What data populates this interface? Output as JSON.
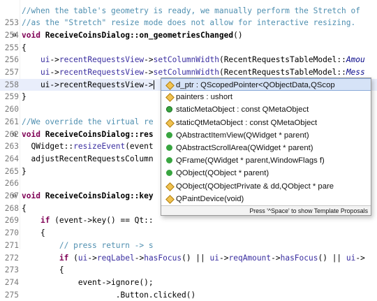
{
  "lines": [
    {
      "num": "",
      "fold": "",
      "tokens": [
        {
          "c": "cm",
          "t": "//when the table's geometry is ready, we manually perform the Stretch of"
        }
      ]
    },
    {
      "num": "253",
      "fold": "",
      "tokens": [
        {
          "c": "cm",
          "t": "//as the \"Stretch\" resize mode does not allow for interactive resizing."
        }
      ]
    },
    {
      "num": "254",
      "fold": "⊖",
      "tokens": [
        {
          "c": "kw",
          "t": "void"
        },
        {
          "c": "pl",
          "t": " "
        },
        {
          "c": "fnb",
          "t": "ReceiveCoinsDialog::on_geometriesChanged"
        },
        {
          "c": "pl",
          "t": "()"
        }
      ]
    },
    {
      "num": "255",
      "fold": "",
      "tokens": [
        {
          "c": "pl",
          "t": "{"
        }
      ]
    },
    {
      "num": "256",
      "fold": "",
      "tokens": [
        {
          "c": "pl",
          "t": "    "
        },
        {
          "c": "fn",
          "t": "ui"
        },
        {
          "c": "pl",
          "t": "->"
        },
        {
          "c": "fn",
          "t": "recentRequestsView"
        },
        {
          "c": "pl",
          "t": "->"
        },
        {
          "c": "fn",
          "t": "setColumnWidth"
        },
        {
          "c": "pl",
          "t": "(RecentRequestsTableModel::"
        },
        {
          "c": "it",
          "t": "Amou"
        }
      ]
    },
    {
      "num": "257",
      "fold": "",
      "tokens": [
        {
          "c": "pl",
          "t": "    "
        },
        {
          "c": "fn",
          "t": "ui"
        },
        {
          "c": "pl",
          "t": "->"
        },
        {
          "c": "fn",
          "t": "recentRequestsView"
        },
        {
          "c": "pl",
          "t": "->"
        },
        {
          "c": "fn",
          "t": "setColumnWidth"
        },
        {
          "c": "pl",
          "t": "(RecentRequestsTableModel::"
        },
        {
          "c": "it",
          "t": "Mess"
        }
      ]
    },
    {
      "num": "258",
      "fold": "",
      "hl": true,
      "caret": true,
      "tokens": [
        {
          "c": "pl",
          "t": "    ui->recentRequestsView->"
        }
      ]
    },
    {
      "num": "259",
      "fold": "",
      "tokens": [
        {
          "c": "pl",
          "t": "}"
        }
      ]
    },
    {
      "num": "260",
      "fold": "",
      "tokens": []
    },
    {
      "num": "261",
      "fold": "",
      "tokens": [
        {
          "c": "cm",
          "t": "//We override the virtual re                              et's c"
        }
      ]
    },
    {
      "num": "262",
      "fold": "⊖",
      "tokens": [
        {
          "c": "kw",
          "t": "void"
        },
        {
          "c": "pl",
          "t": " "
        },
        {
          "c": "fnb",
          "t": "ReceiveCoinsDialog::res"
        }
      ]
    },
    {
      "num": "263",
      "fold": "",
      "tokens": [
        {
          "c": "pl",
          "t": "  QWidget::"
        },
        {
          "c": "fn",
          "t": "resizeEvent"
        },
        {
          "c": "pl",
          "t": "(event"
        }
      ]
    },
    {
      "num": "264",
      "fold": "",
      "tokens": [
        {
          "c": "pl",
          "t": "  adjustRecentRequestsColumn"
        }
      ]
    },
    {
      "num": "265",
      "fold": "",
      "tokens": [
        {
          "c": "pl",
          "t": "}"
        }
      ]
    },
    {
      "num": "266",
      "fold": "",
      "tokens": []
    },
    {
      "num": "267",
      "fold": "⊖",
      "tokens": [
        {
          "c": "kw",
          "t": "void"
        },
        {
          "c": "pl",
          "t": " "
        },
        {
          "c": "fnb",
          "t": "ReceiveCoinsDialog::key"
        }
      ]
    },
    {
      "num": "268",
      "fold": "",
      "tokens": [
        {
          "c": "pl",
          "t": "{"
        }
      ]
    },
    {
      "num": "269",
      "fold": "",
      "tokens": [
        {
          "c": "pl",
          "t": "    "
        },
        {
          "c": "kw",
          "t": "if"
        },
        {
          "c": "pl",
          "t": " (event->key() == Qt::"
        }
      ]
    },
    {
      "num": "270",
      "fold": "",
      "tokens": [
        {
          "c": "pl",
          "t": "    {"
        }
      ]
    },
    {
      "num": "271",
      "fold": "",
      "tokens": [
        {
          "c": "pl",
          "t": "        "
        },
        {
          "c": "cm",
          "t": "// press return -> s"
        }
      ]
    },
    {
      "num": "272",
      "fold": "",
      "tokens": [
        {
          "c": "pl",
          "t": "        "
        },
        {
          "c": "kw",
          "t": "if"
        },
        {
          "c": "pl",
          "t": " ("
        },
        {
          "c": "fn",
          "t": "ui"
        },
        {
          "c": "pl",
          "t": "->"
        },
        {
          "c": "fn",
          "t": "reqLabel"
        },
        {
          "c": "pl",
          "t": "->"
        },
        {
          "c": "fn",
          "t": "hasFocus"
        },
        {
          "c": "pl",
          "t": "() || "
        },
        {
          "c": "fn",
          "t": "ui"
        },
        {
          "c": "pl",
          "t": "->"
        },
        {
          "c": "fn",
          "t": "reqAmount"
        },
        {
          "c": "pl",
          "t": "->"
        },
        {
          "c": "fn",
          "t": "hasFocus"
        },
        {
          "c": "pl",
          "t": "() || "
        },
        {
          "c": "fn",
          "t": "ui"
        },
        {
          "c": "pl",
          "t": "->"
        }
      ]
    },
    {
      "num": "273",
      "fold": "",
      "tokens": [
        {
          "c": "pl",
          "t": "        {"
        }
      ]
    },
    {
      "num": "274",
      "fold": "",
      "tokens": [
        {
          "c": "pl",
          "t": "            event->ignore();"
        }
      ]
    },
    {
      "num": "275",
      "fold": "",
      "tokens": [
        {
          "c": "pl",
          "t": "                    .Button.clicked()"
        }
      ]
    }
  ],
  "popup": {
    "items": [
      {
        "icon": "diamond",
        "label": "d_ptr : QScopedPointer<QObjectData,QScop",
        "selected": true
      },
      {
        "icon": "diamond",
        "label": "painters : ushort"
      },
      {
        "icon": "ring",
        "label": "staticMetaObject : const QMetaObject"
      },
      {
        "icon": "diamond",
        "label": "staticQtMetaObject : const QMetaObject"
      },
      {
        "icon": "green",
        "label": "QAbstractItemView(QWidget * parent)"
      },
      {
        "icon": "green",
        "label": "QAbstractScrollArea(QWidget * parent)"
      },
      {
        "icon": "green",
        "label": "QFrame(QWidget * parent,WindowFlags f)"
      },
      {
        "icon": "green",
        "label": "QObject(QObject * parent)"
      },
      {
        "icon": "diamond",
        "label": "QObject(QObjectPrivate & dd,QObject * pare"
      },
      {
        "icon": "diamond",
        "label": "QPaintDevice(void)"
      }
    ],
    "footer": "Press '^Space' to show Template Proposals"
  }
}
